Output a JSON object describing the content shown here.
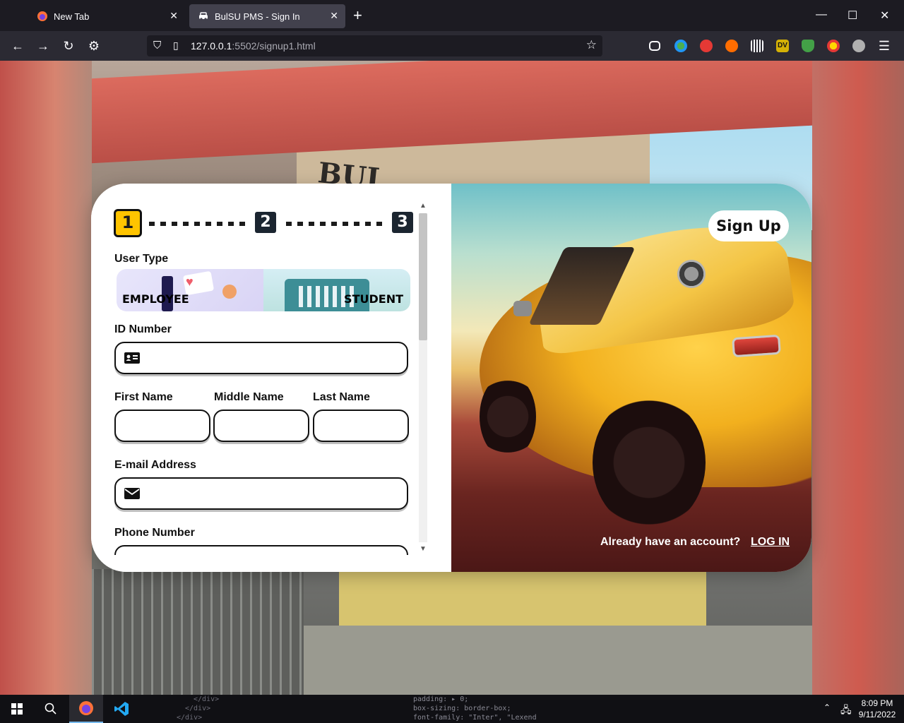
{
  "browser": {
    "tabs": [
      {
        "title": "New Tab"
      },
      {
        "title": "BulSU PMS - Sign In"
      }
    ],
    "url_main": "127.0.0.1",
    "url_rest": ":5502/signup1.html"
  },
  "background": {
    "sign_text": "BUL"
  },
  "form": {
    "steps": [
      "1",
      "2",
      "3"
    ],
    "current_step": 1,
    "user_type_label": "User Type",
    "user_types": [
      "EMPLOYEE",
      "STUDENT"
    ],
    "id_label": "ID Number",
    "id_value": "",
    "first_name_label": "First Name",
    "middle_name_label": "Middle Name",
    "last_name_label": "Last Name",
    "email_label": "E-mail Address",
    "phone_label": "Phone Number"
  },
  "promo": {
    "signup_label": "Sign Up",
    "already_text": "Already have an account?",
    "login_label": "LOG IN"
  },
  "taskbar": {
    "code_left": [
      "</div>",
      "</div>",
      "</div>"
    ],
    "code_right": [
      "padding: ▸ 0;",
      "box-sizing: border-box;",
      "font-family: \"Inter\", \"Lexend"
    ],
    "time": "8:09 PM",
    "date": "9/11/2022"
  },
  "colors": {
    "accent_yellow": "#ffc400",
    "step_dark": "#1b2530",
    "browser_bg": "#1c1b22",
    "toolbar_bg": "#2b2a33"
  },
  "icons": {
    "firefox": "firefox-icon",
    "car": "car-icon",
    "id_card": "id-card-icon",
    "mail": "mail-icon",
    "phone": "phone-icon"
  }
}
